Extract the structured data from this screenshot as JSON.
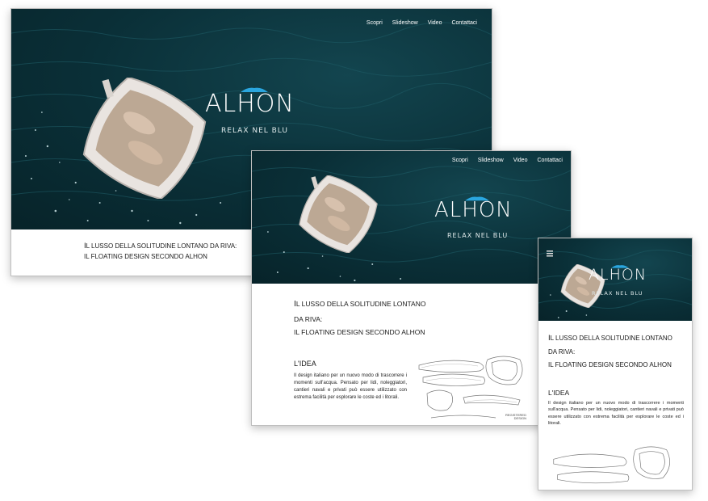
{
  "brand": {
    "name": "ALHON",
    "tagline": "RELAX NEL BLU",
    "accent": "#2aa6df"
  },
  "nav": {
    "items": [
      "Scopri",
      "Slideshow",
      "Video",
      "Contattaci"
    ]
  },
  "intro": {
    "line1_first": "I",
    "line1_rest": "L LUSSO DELLA SOLITUDINE LONTANO",
    "line1_full_rest": "L LUSSO DELLA SOLITUDINE LONTANO DA RIVA:",
    "line2": "DA RIVA:",
    "line3": "IL FLOATING DESIGN SECONDO ALHON"
  },
  "idea": {
    "title": "L'IDEA",
    "text_tablet": "Il design italiano per un nuovo modo di trascorrere i momenti sull'acqua. Pensato per lidi, noleggiatori, cantieri navali e privati può essere utilizzato con estrema facilità per esplorare le coste ed i litorali.",
    "text_mobile": "Il design italiano per un nuovo modo di trascorrere i momenti sull'acqua. Pensato per lidi, noleggiatori, cantieri navali e privati può essere utilizzato con estrema facilità per esplorare le coste ed i litorali.",
    "sketch_caption": "REGISTERED DESIGN"
  },
  "colors": {
    "sea_dark": "#072329",
    "sea_mid": "#13454f",
    "text": "#1a1a1a"
  }
}
